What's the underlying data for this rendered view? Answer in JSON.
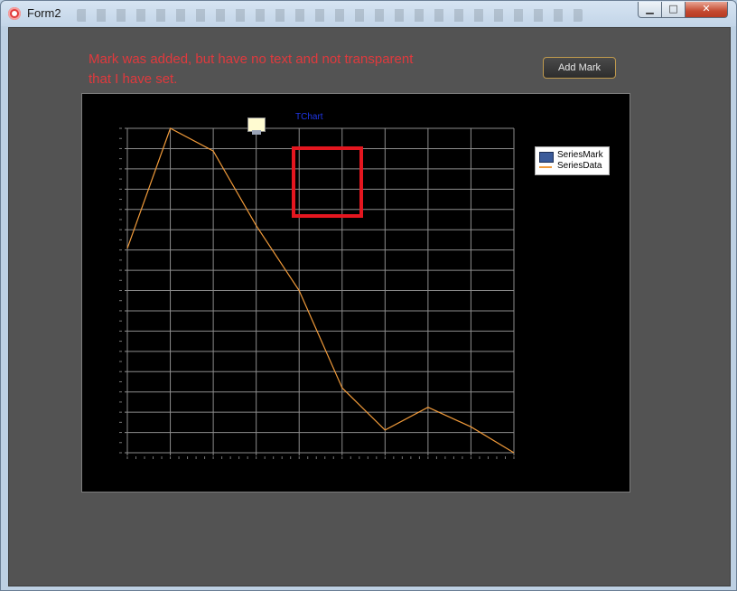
{
  "window": {
    "title": "Form2",
    "minimize_glyph": "▁",
    "maximize_glyph": "□",
    "close_glyph": "✕"
  },
  "note": {
    "line1": "Mark was added, but have no text and not transparent",
    "line2": "that I have set."
  },
  "add_mark_button": {
    "label": "Add Mark"
  },
  "colors": {
    "note": "#e0393d",
    "series_data": "#f09a3a",
    "series_mark": "#3b5b9a",
    "chart_bg": "#000000",
    "highlight": "#e4161f"
  },
  "chart_data": {
    "type": "line",
    "title": "TChart",
    "grid": true,
    "legend_position": "top-right",
    "series": [
      {
        "name": "SeriesMark",
        "kind": "bar",
        "values": []
      },
      {
        "name": "SeriesData",
        "kind": "line",
        "values": [
          0.63,
          1.0,
          0.93,
          0.7,
          0.5,
          0.2,
          0.07,
          0.14,
          0.08,
          0.0
        ]
      }
    ],
    "x_points": 10,
    "grid_columns": 9,
    "grid_rows": 16,
    "ylim": [
      0,
      1
    ]
  }
}
